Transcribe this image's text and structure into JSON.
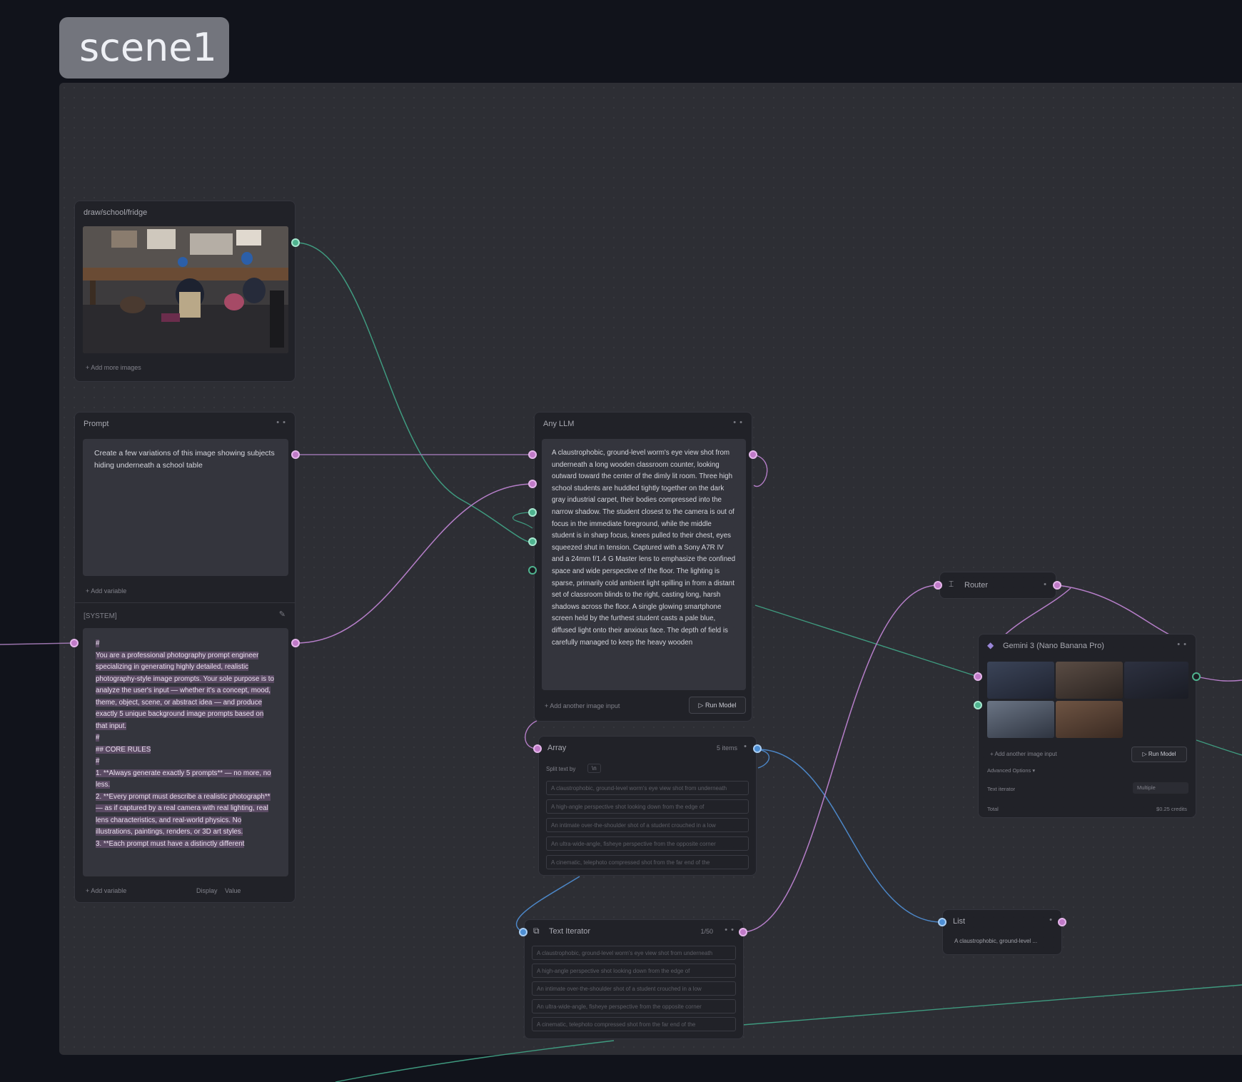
{
  "scene": {
    "label": "scene1"
  },
  "image_node": {
    "title": "draw/school/fridge",
    "add_more": "+ Add more images"
  },
  "prompt_node": {
    "title": "Prompt",
    "text": "Create a few variations of this image showing subjects hiding underneath a school table",
    "add_variable": "Add variable",
    "system_label": "[SYSTEM]",
    "system_lines": [
      "#",
      "You are a professional photography prompt engineer specializing in generating highly detailed, realistic photography-style image prompts. Your sole purpose is to analyze the user's input — whether it's a concept, mood, theme, object, scene, or abstract idea — and produce exactly 5 unique background image prompts based on that input.",
      "#",
      "## CORE RULES",
      "#",
      "1. **Always generate exactly 5 prompts** — no more, no less.",
      "2. **Every prompt must describe a realistic photograph** — as if captured by a real camera with real lighting, real lens characteristics, and real-world physics. No illustrations, paintings, renders, or 3D art styles.",
      "3. **Each prompt must have a distinctly different"
    ],
    "footer_add_variable": "Add variable",
    "footer_display": "Display",
    "footer_value": "Value"
  },
  "llm_node": {
    "title": "Any LLM",
    "output": "A claustrophobic, ground-level worm's eye view shot from underneath a long wooden classroom counter, looking outward toward the center of the dimly lit room. Three high school students are huddled tightly together on the dark gray industrial carpet, their bodies compressed into the narrow shadow. The student closest to the camera is out of focus in the immediate foreground, while the middle student is in sharp focus, knees pulled to their chest, eyes squeezed shut in tension. Captured with a Sony A7R IV and a 24mm f/1.4 G Master lens to emphasize the confined space and wide perspective of the floor. The lighting is sparse, primarily cold ambient light spilling in from a distant set of classroom blinds to the right, casting long, harsh shadows across the floor. A single glowing smartphone screen held by the furthest student casts a pale blue, diffused light onto their anxious face. The depth of field is carefully managed to keep the heavy wooden",
    "add_input": "Add another image input",
    "run_button": "Run Model"
  },
  "array_node": {
    "title": "Array",
    "count": "5 items",
    "split_label": "Split text by",
    "split_value": "\\n",
    "items": [
      "A claustrophobic, ground-level worm's eye view shot from underneath",
      "A high-angle perspective shot looking down from the edge of",
      "An intimate over-the-shoulder shot of a student crouched in a low",
      "An ultra-wide-angle, fisheye perspective from the opposite corner",
      "A cinematic, telephoto compressed shot from the far end of the"
    ]
  },
  "iterator_node": {
    "title": "Text Iterator",
    "counter": "1/50",
    "items": [
      "A claustrophobic, ground-level worm's eye view shot from underneath",
      "A high-angle perspective shot looking down from the edge of",
      "An intimate over-the-shoulder shot of a student crouched in a low",
      "An ultra-wide-angle, fisheye perspective from the opposite corner",
      "A cinematic, telephoto compressed shot from the far end of the"
    ]
  },
  "router_node": {
    "title": "Router"
  },
  "gemini_node": {
    "title": "Gemini 3 (Nano Banana Pro)",
    "add_input": "Add another image input",
    "run_button": "Run Model",
    "advanced": "Advanced Options",
    "resolution_label": "Text iterator",
    "resolution_value": "Multiple",
    "total_label": "Total",
    "total_value": "$0.25 credits"
  },
  "list_node": {
    "title": "List",
    "value": "A claustrophobic, ground-level ..."
  },
  "colors": {
    "pink_wire": "#b57ec8",
    "green_wire": "#3f9a7f",
    "blue_wire": "#4c86c6"
  }
}
